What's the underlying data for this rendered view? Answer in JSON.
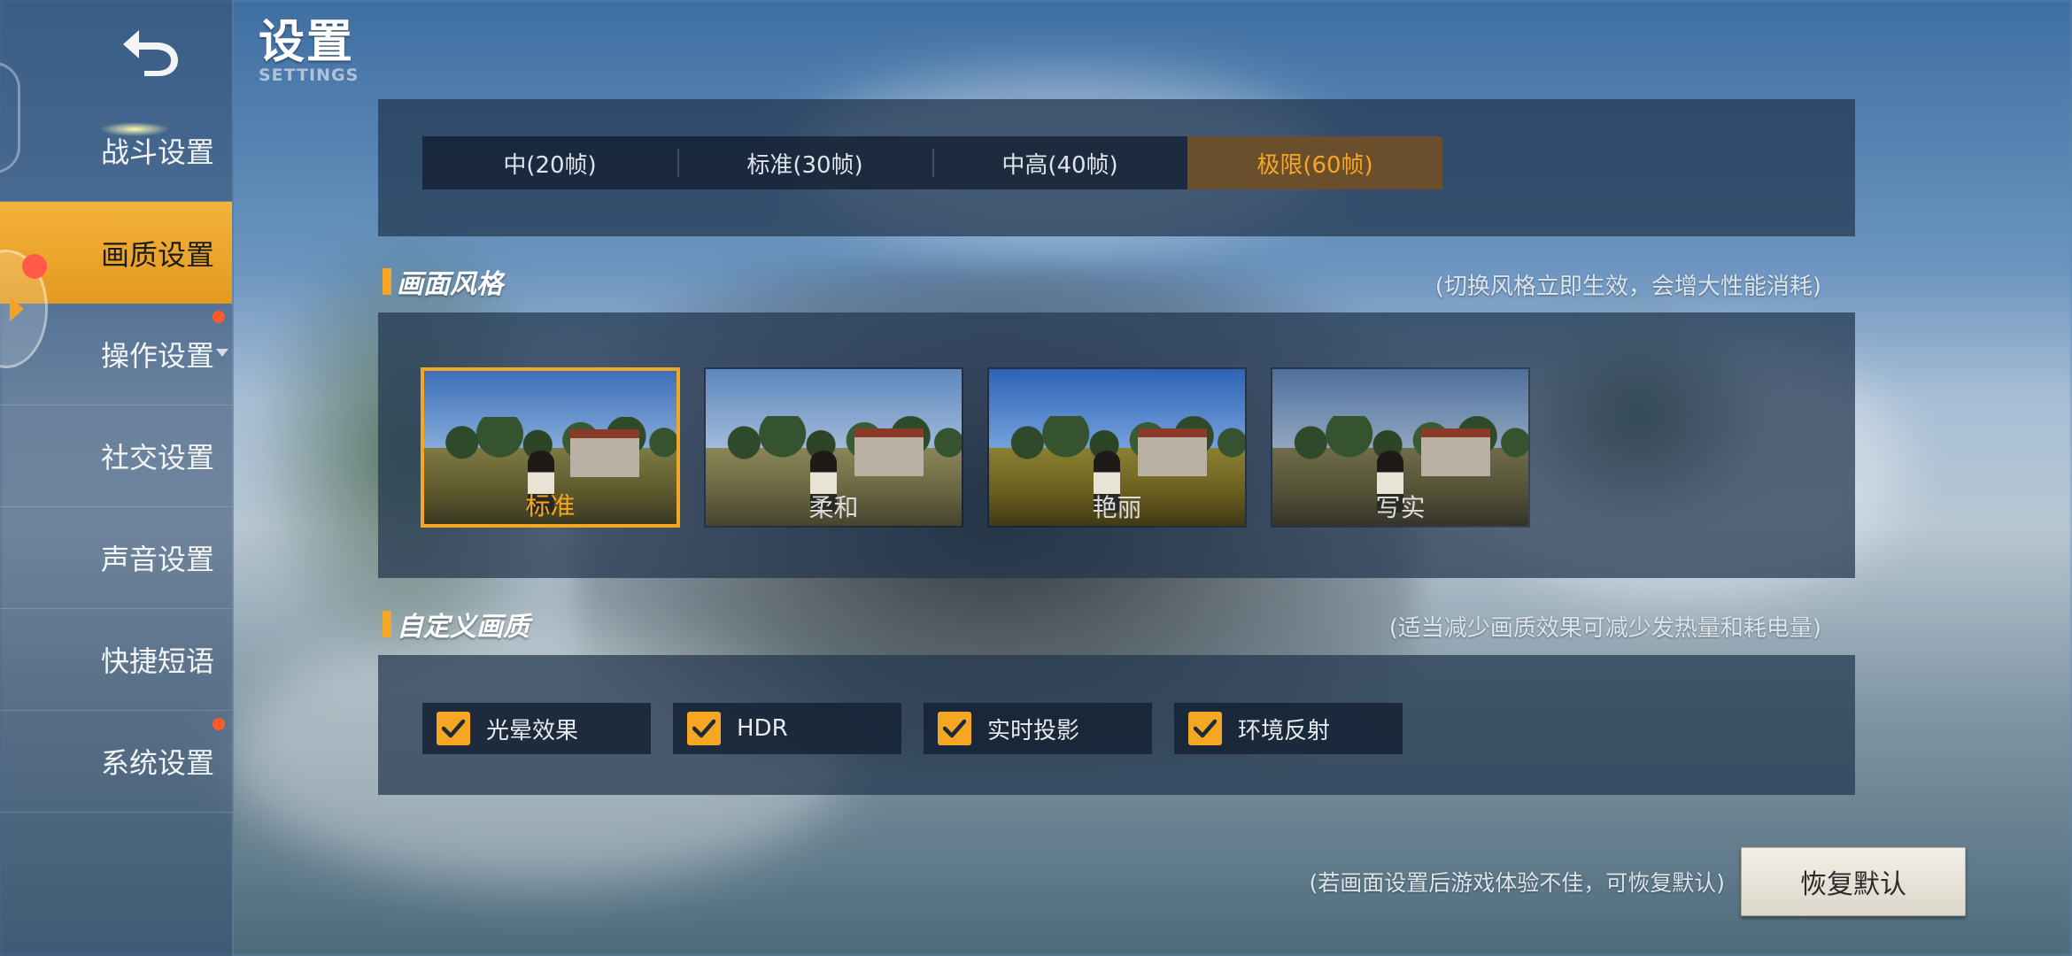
{
  "header": {
    "title": "设置",
    "subtitle": "SETTINGS"
  },
  "sidebar": {
    "items": [
      {
        "label": "战斗设置",
        "active": false,
        "badge": false
      },
      {
        "label": "画质设置",
        "active": true,
        "badge": false
      },
      {
        "label": "操作设置",
        "active": false,
        "badge": true,
        "dropdown": true
      },
      {
        "label": "社交设置",
        "active": false,
        "badge": false
      },
      {
        "label": "声音设置",
        "active": false,
        "badge": false
      },
      {
        "label": "快捷短语",
        "active": false,
        "badge": false
      },
      {
        "label": "系统设置",
        "active": false,
        "badge": true
      }
    ]
  },
  "frame_rate": {
    "options": [
      "中(20帧)",
      "标准(30帧)",
      "中高(40帧)",
      "极限(60帧)"
    ],
    "selected": "极限(60帧)"
  },
  "style_section": {
    "title": "画面风格",
    "note": "(切换风格立即生效，会增大性能消耗)",
    "options": [
      "标准",
      "柔和",
      "艳丽",
      "写实"
    ],
    "selected": "标准"
  },
  "custom_section": {
    "title": "自定义画质",
    "note": "(适当减少画质效果可减少发热量和耗电量)",
    "checkboxes": [
      {
        "label": "光晕效果",
        "checked": true
      },
      {
        "label": "HDR",
        "checked": true
      },
      {
        "label": "实时投影",
        "checked": true
      },
      {
        "label": "环境反射",
        "checked": true
      }
    ]
  },
  "footer": {
    "note": "(若画面设置后游戏体验不佳，可恢复默认)",
    "reset_label": "恢复默认"
  },
  "colors": {
    "accent": "#f5a623",
    "panel": "#23364f",
    "badge": "#ff5a2c"
  }
}
